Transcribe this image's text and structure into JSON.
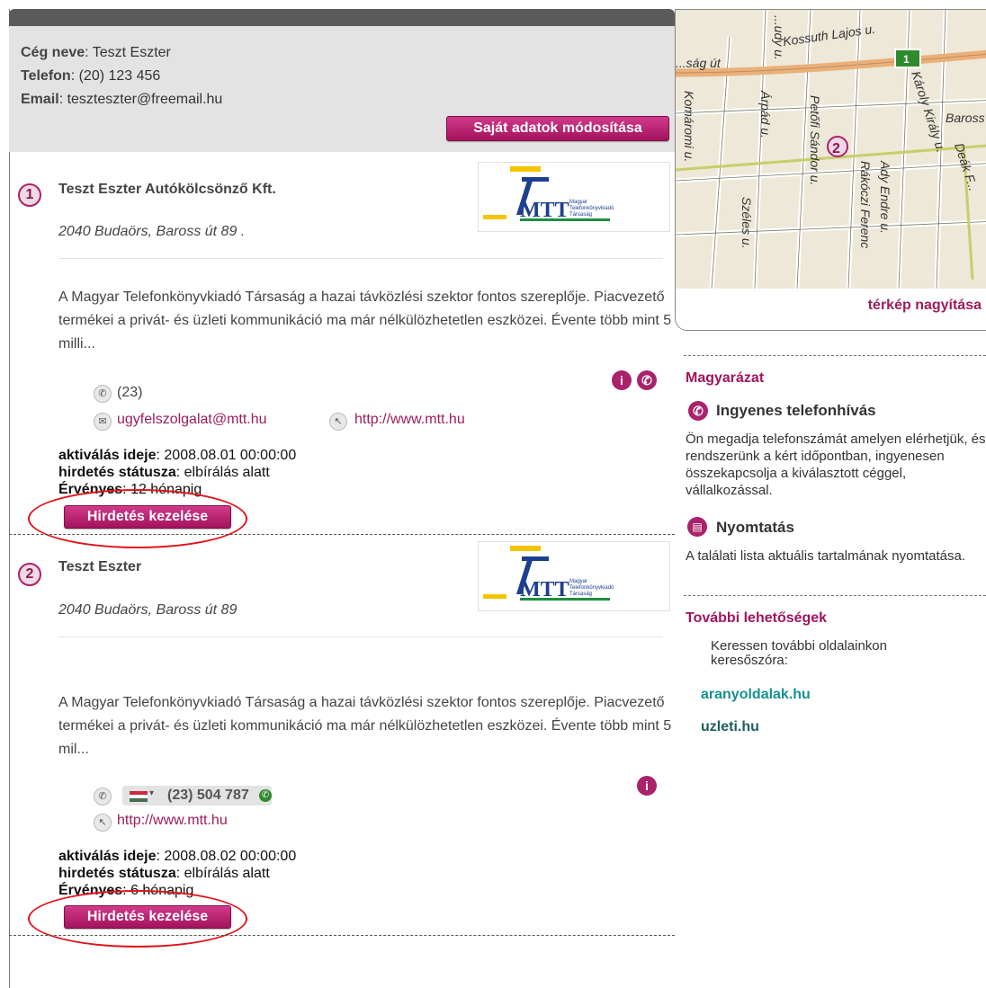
{
  "profile": {
    "company_label": "Cég neve",
    "company_value": "Teszt Eszter",
    "phone_label": "Telefon",
    "phone_value": "(20) 123 456",
    "email_label": "Email",
    "email_value": "teszteszter@freemail.hu",
    "edit_button": "Saját adatok módosítása"
  },
  "listings": [
    {
      "number": "1",
      "title": "Teszt Eszter Autókölcsönző Kft.",
      "address": "2040 Budaörs, Baross út 89 .",
      "description": "A Magyar Telefonkönyvkiadó Társaság a hazai távközlési szektor fontos szereplője. Piacvezető termékei a privát- és üzleti kommunikáció ma már nélkülözhetetlen eszközei. Évente több mint 5 milli...",
      "phone": "(23)",
      "email": "ugyfelszolgalat@mtt.hu",
      "website": "http://www.mtt.hu",
      "activation_label": "aktiválás ideje",
      "activation_value": "2008.08.01 00:00:00",
      "status_label": "hirdetés státusza",
      "status_value": "elbírálás alatt",
      "valid_label": "Érvényes",
      "valid_value": "12 hónapig",
      "manage_button": "Hirdetés kezelése"
    },
    {
      "number": "2",
      "title": "Teszt Eszter",
      "address": "2040 Budaörs, Baross út 89",
      "description": "A Magyar Telefonkönyvkiadó Társaság a hazai távközlési szektor fontos szereplője. Piacvezető termékei a privát- és üzleti kommunikáció ma már nélkülözhetetlen eszközei. Évente több mint 5 mil...",
      "phone": "(23) 504 787",
      "website": "http://www.mtt.hu",
      "activation_label": "aktiválás ideje",
      "activation_value": "2008.08.02 00:00:00",
      "status_label": "hirdetés státusza",
      "status_value": "elbírálás alatt",
      "valid_label": "Érvényes",
      "valid_value": "6 hónapig",
      "manage_button": "Hirdetés kezelése"
    }
  ],
  "logo": {
    "letters": "MTT",
    "line1": "Magyar",
    "line2": "Telefonkönyvkiadó",
    "line3": "Társaság"
  },
  "map": {
    "zoom_link": "térkép nagyítása",
    "marker": "2",
    "road_sign": "1",
    "streets": [
      "Kossuth Lajos u.",
      "...ság út",
      "Károly Király u.",
      "Baross",
      "Deák F...",
      "Petőfi Sándor u.",
      "Árpád u.",
      "Komáromi u.",
      "Ady Endre u.",
      "Rákóczi Ferenc",
      "Széles u.",
      "...udy u."
    ]
  },
  "legend": {
    "heading": "Magyarázat",
    "free_call_title": "Ingyenes telefonhívás",
    "free_call_text": "Ön megadja telefonszámát amelyen elérhetjük, és rendszerünk a kért időpontban, ingyenesen összekapcsolja a kiválasztott céggel, vállalkozással.",
    "print_title": "Nyomtatás",
    "print_text": "A találati lista aktuális tartalmának nyomtatása."
  },
  "more": {
    "heading": "További lehetőségek",
    "text": "Keressen további oldalainkon keresőszóra:",
    "link1": "aranyoldalak.hu",
    "link2": "uzleti.hu"
  },
  "colors": {
    "accent": "#a3135d",
    "link_teal": "#179090",
    "link_dark": "#1f5f5f",
    "annotation": "#e0141c"
  }
}
